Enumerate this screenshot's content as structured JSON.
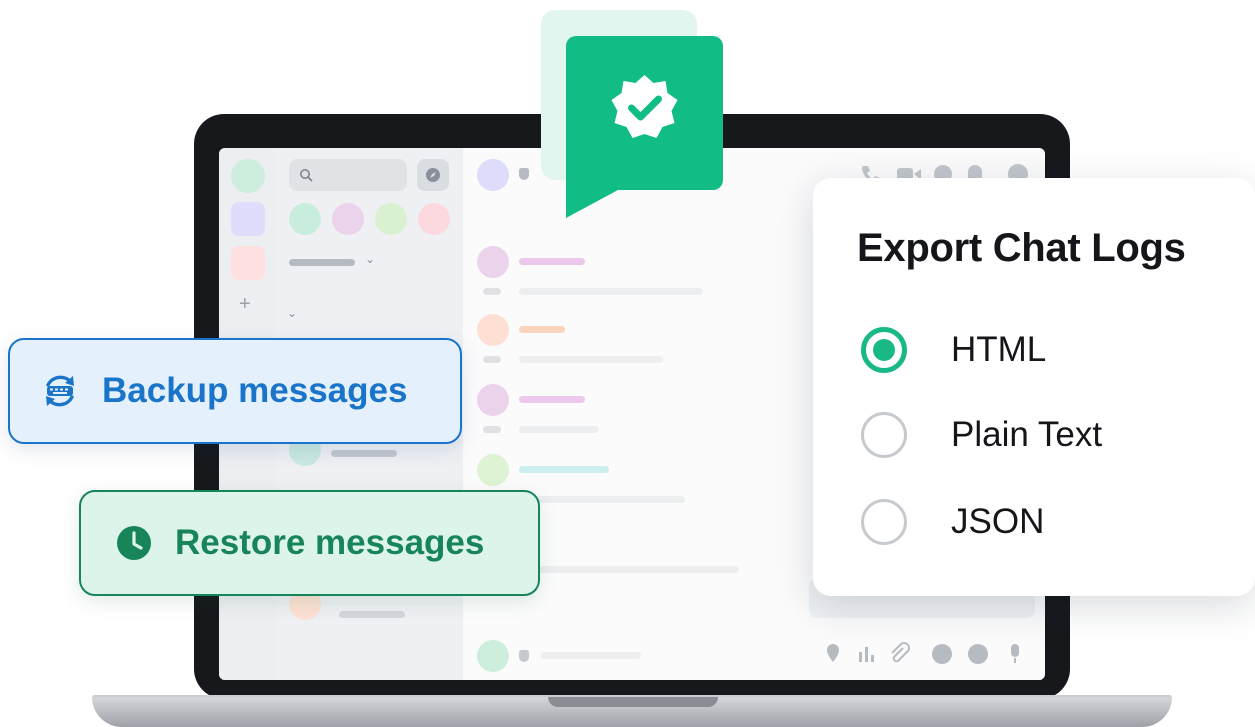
{
  "export_card": {
    "title": "Export Chat Logs",
    "options": [
      {
        "label": "HTML",
        "selected": true
      },
      {
        "label": "Plain Text",
        "selected": false
      },
      {
        "label": "JSON",
        "selected": false
      }
    ]
  },
  "actions": {
    "backup_label": "Backup messages",
    "restore_label": "Restore messages"
  },
  "icons": {
    "backup": "sync-keyboard-icon",
    "restore": "clock-icon",
    "verified": "verified-badge-icon"
  },
  "colors": {
    "accent_green": "#18b987",
    "backup_blue": "#1a74c9",
    "restore_green": "#17845a"
  }
}
